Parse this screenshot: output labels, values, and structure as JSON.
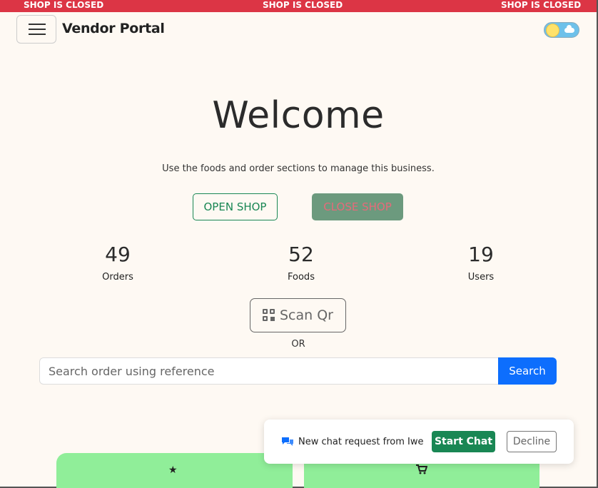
{
  "banner": {
    "items": [
      "SHOP IS CLOSED",
      "SHOP IS CLOSED",
      "SHOP IS CLOSED"
    ],
    "color": "#dc3545"
  },
  "navbar": {
    "brand": "Vendor Portal",
    "menu_icon": "hamburger-icon",
    "theme_toggle_icon": "sun-cloud-toggle-icon"
  },
  "hero": {
    "title": "Welcome",
    "subtitle": "Use the foods and order sections to manage this business."
  },
  "shop_controls": {
    "open_label": "OPEN SHOP",
    "close_label": "CLOSE SHOP"
  },
  "stats": [
    {
      "value": "49",
      "label": "Orders"
    },
    {
      "value": "52",
      "label": "Foods"
    },
    {
      "value": "19",
      "label": "Users"
    }
  ],
  "scan": {
    "label": "Scan Qr",
    "icon": "qr-code-icon",
    "or_text": "OR"
  },
  "search": {
    "placeholder": "Search order using reference",
    "button_label": "Search"
  },
  "cards": [
    {
      "icon": "star-icon",
      "glyph": "★"
    },
    {
      "icon": "cart-icon",
      "glyph": "🛒"
    }
  ],
  "toast": {
    "icon": "chat-bubbles-icon",
    "message": "New chat request from Iwe",
    "start_label": "Start Chat",
    "decline_label": "Decline"
  },
  "colors": {
    "background": "#fef9f3",
    "success": "#198754",
    "primary": "#0d6efd",
    "card": "#90ee99"
  }
}
